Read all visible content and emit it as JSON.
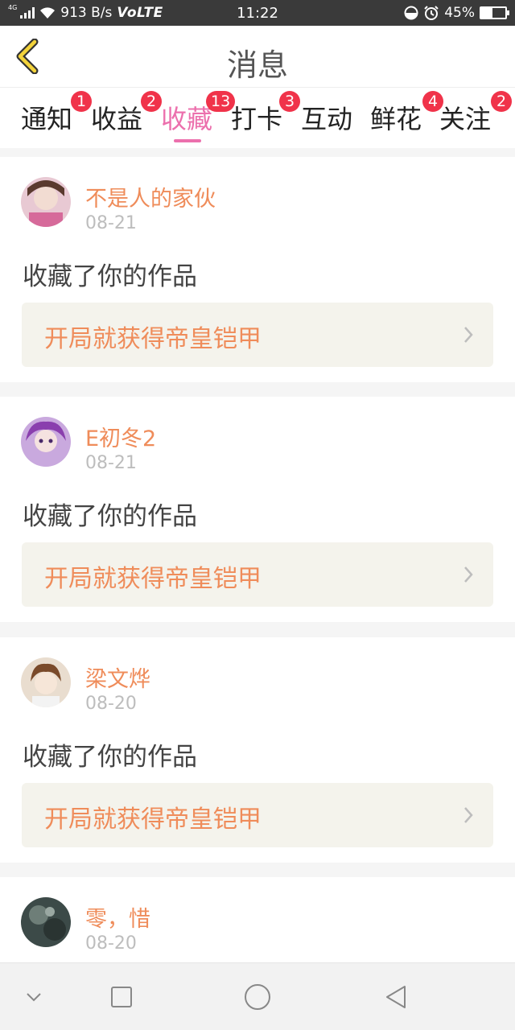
{
  "status_bar": {
    "network_type": "4G",
    "speed": "913 B/s",
    "volte": "VoLTE",
    "time": "11:22",
    "battery_percent": "45%",
    "battery_level": 0.45
  },
  "header": {
    "title": "消息"
  },
  "tabs": [
    {
      "label": "通知",
      "badge": "1"
    },
    {
      "label": "收益",
      "badge": "2"
    },
    {
      "label": "收藏",
      "badge": "13",
      "active": true
    },
    {
      "label": "打卡",
      "badge": "3"
    },
    {
      "label": "互动",
      "badge": ""
    },
    {
      "label": "鲜花",
      "badge": "4"
    },
    {
      "label": "关注",
      "badge": "2"
    }
  ],
  "messages": [
    {
      "user": "不是人的家伙",
      "date": "08-21",
      "action": "收藏了你的作品",
      "work": "开局就获得帝皇铠甲",
      "avatar_color": "#b06a8a"
    },
    {
      "user": "E初冬2",
      "date": "08-21",
      "action": "收藏了你的作品",
      "work": "开局就获得帝皇铠甲",
      "avatar_color": "#8a4fa8"
    },
    {
      "user": "梁文烨",
      "date": "08-20",
      "action": "收藏了你的作品",
      "work": "开局就获得帝皇铠甲",
      "avatar_color": "#8a5a3a"
    },
    {
      "user": "零，惜",
      "date": "08-20",
      "action": "",
      "work": "",
      "avatar_color": "#3c4a48"
    }
  ],
  "colors": {
    "accent_pink": "#ec70ad",
    "username_orange": "#ef8c5a",
    "badge_red": "#f0334a"
  },
  "icons": {
    "back": "chevron-left-icon",
    "work_arrow": "chevron-right-icon",
    "nav": [
      "chevron-down-icon",
      "square-icon",
      "circle-icon",
      "triangle-back-icon"
    ]
  }
}
